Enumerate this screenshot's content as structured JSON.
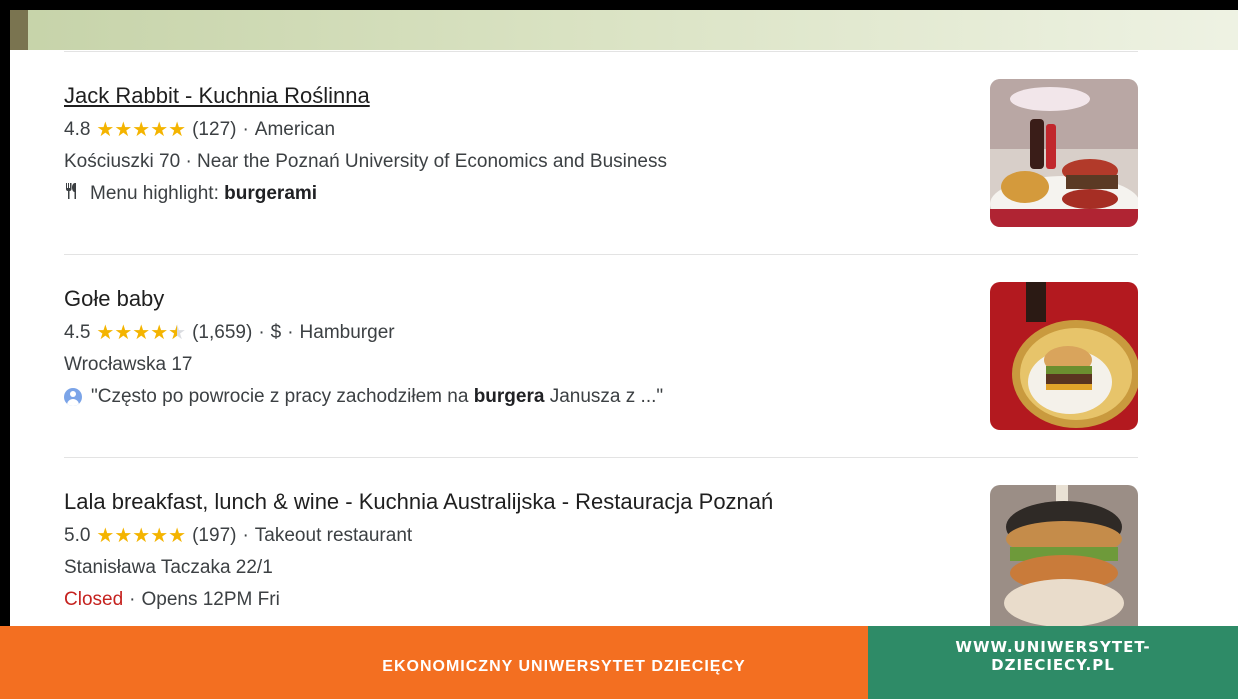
{
  "results": [
    {
      "name": "Jack Rabbit - Kuchnia Roślinna",
      "rating": "4.8",
      "stars_value": 4.8,
      "reviews": "(127)",
      "meta": "American",
      "address": "Kościuszki 70 · Near the Poznań University of Economics and Business",
      "highlight_prefix": "Menu highlight:",
      "highlight_bold": "burgerami"
    },
    {
      "name": "Gołe baby",
      "rating": "4.5",
      "stars_value": 4.5,
      "reviews": "(1,659)",
      "price": "$",
      "meta": "Hamburger",
      "address": "Wrocławska 17",
      "review_prefix": "\"Często po powrocie z pracy zachodziłem na",
      "review_bold": "burgera",
      "review_suffix": "Janusza z ...\""
    },
    {
      "name": "Lala breakfast, lunch & wine - Kuchnia Australijska - Restauracja Poznań",
      "rating": "5.0",
      "stars_value": 5.0,
      "reviews": "(197)",
      "meta": "Takeout restaurant",
      "address": "Stanisława Taczaka 22/1",
      "status": "Closed",
      "hours": "Opens 12PM Fri"
    }
  ],
  "separator": "·",
  "icons": {
    "menu": "fork-knife-icon",
    "user": "user-avatar-icon",
    "star": "star-icon"
  },
  "footer": {
    "left": "EKONOMICZNY UNIWERSYTET DZIECIĘCY",
    "right": "WWW.UNIWERSYTET-DZIECIECY.PL"
  },
  "colors": {
    "star": "#f4b400",
    "closed": "#c5221f",
    "footer_orange": "#f36f21",
    "footer_green": "#2e8b67"
  }
}
